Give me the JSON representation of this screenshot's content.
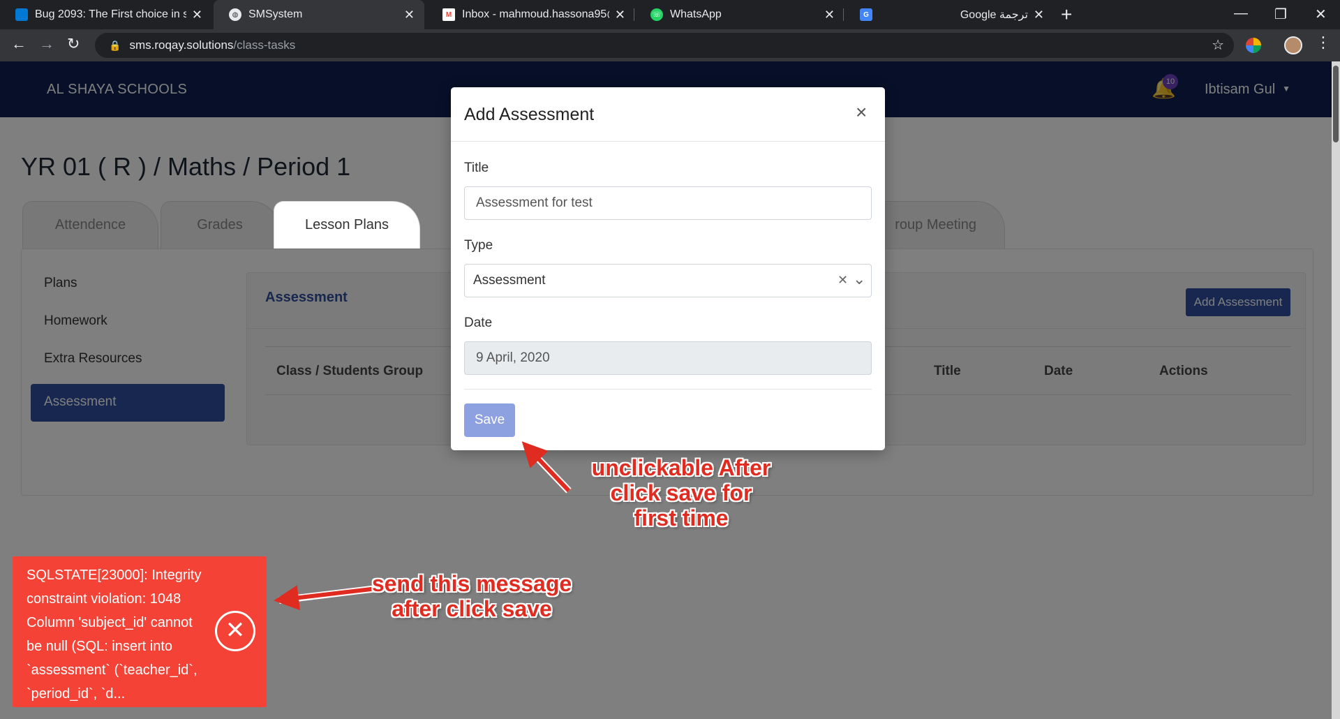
{
  "browser": {
    "tabs": [
      {
        "title": "Bug 2093: The First choice in sele",
        "icon": "azure-devops-icon",
        "color": "#0078d4"
      },
      {
        "title": "SMSystem",
        "icon": "globe-icon",
        "color": "#e8eaed"
      },
      {
        "title": "Inbox - mahmoud.hassona95@g",
        "icon": "gmail-icon",
        "color": "#ea4335"
      },
      {
        "title": "WhatsApp",
        "icon": "whatsapp-icon",
        "color": "#25d366"
      },
      {
        "title": "Google ترجمة",
        "icon": "google-translate-icon",
        "color": "#4285f4"
      }
    ],
    "url_host": "sms.roqay.solutions",
    "url_path": "/class-tasks"
  },
  "app": {
    "brand": "AL SHAYA SCHOOLS",
    "notification_count": "10",
    "user_name": "Ibtisam Gul"
  },
  "page": {
    "title": "YR 01 ( R ) / Maths / Period 1",
    "tabs": [
      "Attendence",
      "Grades",
      "Lesson Plans",
      "roup Meeting"
    ],
    "sidebar": [
      "Plans",
      "Homework",
      "Extra Resources",
      "Assessment"
    ],
    "card_title": "Assessment",
    "add_button": "Add Assessment",
    "table_headers": [
      "Class / Students Group",
      "Title",
      "Date",
      "Actions"
    ]
  },
  "modal": {
    "title": "Add Assessment",
    "close": "×",
    "title_label": "Title",
    "title_value": "Assessment for test",
    "type_label": "Type",
    "type_value": "Assessment",
    "date_label": "Date",
    "date_value": "9 April, 2020",
    "save_label": "Save"
  },
  "annotations": {
    "save_note": "unclickable After click save for first time",
    "toast_note": "send this message after click save",
    "color": "#e02b20"
  },
  "toast": {
    "message": "SQLSTATE[23000]: Integrity constraint violation: 1048 Column 'subject_id' cannot be null (SQL: insert into `assessment` (`teacher_id`, `period_id`, `d..."
  }
}
